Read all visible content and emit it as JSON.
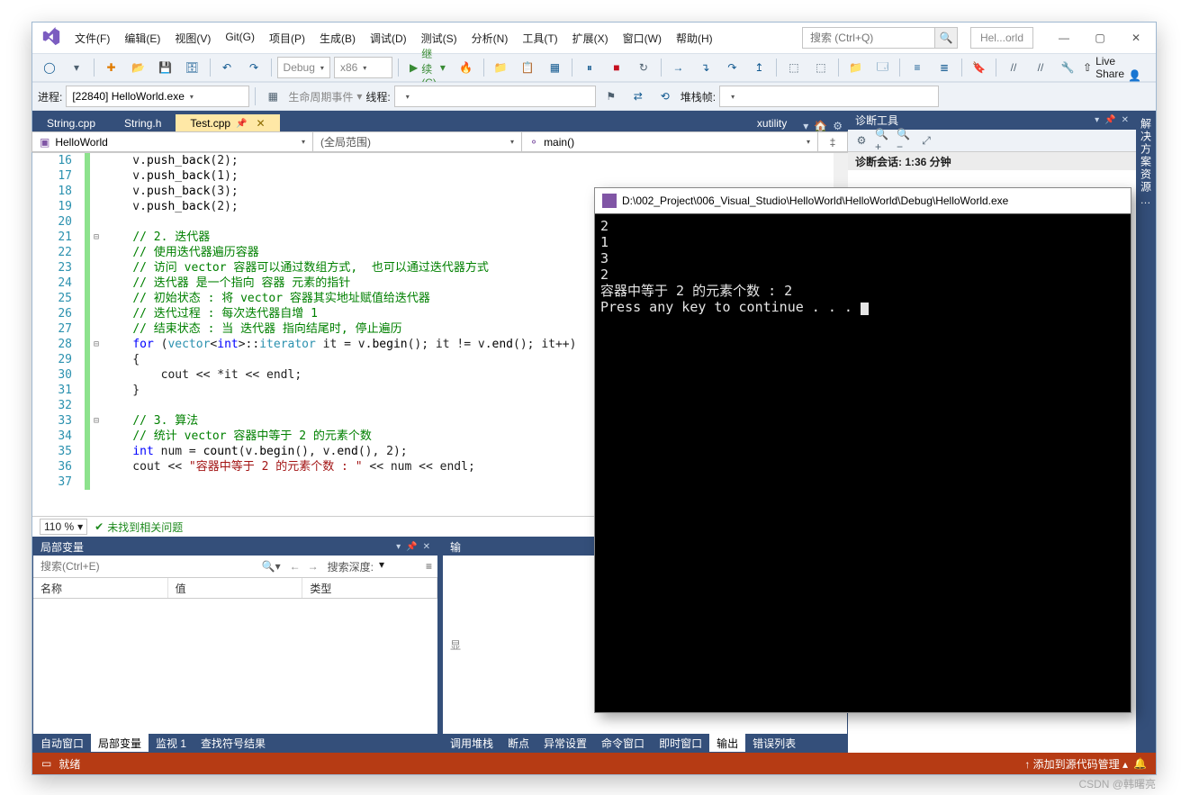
{
  "title_search_placeholder": "搜索 (Ctrl+Q)",
  "solution_pill": "Hel...orld",
  "menus": [
    "文件(F)",
    "编辑(E)",
    "视图(V)",
    "Git(G)",
    "项目(P)",
    "生成(B)",
    "调试(D)",
    "测试(S)",
    "分析(N)",
    "工具(T)",
    "扩展(X)",
    "窗口(W)",
    "帮助(H)"
  ],
  "toolbar1": {
    "config": "Debug",
    "platform": "x86",
    "continue": "继续(C)"
  },
  "liveshare": "Live Share",
  "toolbar2": {
    "process_label": "进程:",
    "process": "[22840] HelloWorld.exe",
    "lifecycle": "生命周期事件",
    "thread_label": "线程:",
    "stackframe": "堆栈帧:"
  },
  "tabs": {
    "t1": "String.cpp",
    "t2": "String.h",
    "t3": "Test.cpp",
    "rt": "xutility"
  },
  "nav": {
    "project": "HelloWorld",
    "scope": "(全局范围)",
    "func": "main()"
  },
  "zoom": "110 %",
  "no_issues": "未找到相关问题",
  "code": {
    "lines": [
      {
        "n": 16,
        "fold": "",
        "html": "v.<span class='fn'>push_back</span>(2);"
      },
      {
        "n": 17,
        "fold": "",
        "html": "v.<span class='fn'>push_back</span>(1);"
      },
      {
        "n": 18,
        "fold": "",
        "html": "v.<span class='fn'>push_back</span>(3);"
      },
      {
        "n": 19,
        "fold": "",
        "html": "v.<span class='fn'>push_back</span>(2);"
      },
      {
        "n": 20,
        "fold": "",
        "html": ""
      },
      {
        "n": 21,
        "fold": "⊟",
        "html": "<span class='cm'>// 2. 迭代器</span>"
      },
      {
        "n": 22,
        "fold": "",
        "html": "<span class='cm'>// 使用迭代器遍历容器</span>"
      },
      {
        "n": 23,
        "fold": "",
        "html": "<span class='cm'>// 访问 vector 容器可以通过数组方式,  也可以通过迭代器方式</span>"
      },
      {
        "n": 24,
        "fold": "",
        "html": "<span class='cm'>// 迭代器 是一个指向 容器 元素的指针</span>"
      },
      {
        "n": 25,
        "fold": "",
        "html": "<span class='cm'>// 初始状态 : 将 vector 容器其实地址赋值给迭代器</span>"
      },
      {
        "n": 26,
        "fold": "",
        "html": "<span class='cm'>// 迭代过程 : 每次迭代器自增 1</span>"
      },
      {
        "n": 27,
        "fold": "",
        "html": "<span class='cm'>// 结束状态 : 当 迭代器 指向结尾时, 停止遍历</span>"
      },
      {
        "n": 28,
        "fold": "⊟",
        "html": "<span class='kw'>for</span> (<span class='tp'>vector</span>&lt;<span class='kw'>int</span>&gt;::<span class='tp'>iterator</span> it = v.<span class='fn'>begin</span>(); it != v.<span class='fn'>end</span>(); it++)"
      },
      {
        "n": 29,
        "fold": "",
        "html": "{"
      },
      {
        "n": 30,
        "fold": "",
        "html": "    cout &lt;&lt; *it &lt;&lt; endl;"
      },
      {
        "n": 31,
        "fold": "",
        "html": "}"
      },
      {
        "n": 32,
        "fold": "",
        "html": ""
      },
      {
        "n": 33,
        "fold": "⊟",
        "html": "<span class='cm'>// 3. 算法</span>"
      },
      {
        "n": 34,
        "fold": "",
        "html": "<span class='cm'>// 统计 vector 容器中等于 2 的元素个数</span>"
      },
      {
        "n": 35,
        "fold": "",
        "html": "<span class='kw'>int</span> num = <span class='fn'>count</span>(v.<span class='fn'>begin</span>(), v.<span class='fn'>end</span>(), 2);"
      },
      {
        "n": 36,
        "fold": "",
        "html": "cout &lt;&lt; <span class='str'>\"容器中等于 2 的元素个数 : \"</span> &lt;&lt; num &lt;&lt; endl;"
      },
      {
        "n": 37,
        "fold": "",
        "html": ""
      }
    ]
  },
  "locals": {
    "title": "局部变量",
    "search_ph": "搜索(Ctrl+E)",
    "depth_label": "搜索深度:",
    "cols": [
      "名称",
      "值",
      "类型"
    ]
  },
  "bottom_left_tabs": [
    "自动窗口",
    "局部变量",
    "监视 1",
    "查找符号结果"
  ],
  "bottom_right_tabs": [
    "调用堆栈",
    "断点",
    "异常设置",
    "命令窗口",
    "即时窗口",
    "输出",
    "错误列表"
  ],
  "output": {
    "title": "输"
  },
  "diag": {
    "title": "诊断工具",
    "session": "诊断会话: 1:36 分钟"
  },
  "side_label": "解决方案资源…",
  "status": {
    "ready": "就绪",
    "add_src": "添加到源代码管理"
  },
  "console": {
    "title": "D:\\002_Project\\006_Visual_Studio\\HelloWorld\\HelloWorld\\Debug\\HelloWorld.exe",
    "lines": [
      "2",
      "1",
      "3",
      "2",
      "容器中等于 2 的元素个数 : 2",
      "Press any key to continue . . . "
    ]
  },
  "watermark": "CSDN @韩曙亮"
}
